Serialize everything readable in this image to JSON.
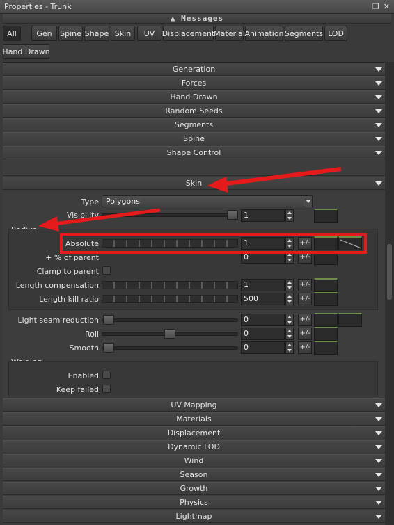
{
  "window": {
    "title": "Properties - Trunk",
    "restore_icon": "restore-icon",
    "close_icon": "close-icon"
  },
  "messages": {
    "label": "Messages"
  },
  "tabs": [
    "All",
    "Gen",
    "Spine",
    "Shape",
    "Skin",
    "UV",
    "Displacement",
    "Material",
    "Animation",
    "Segments",
    "LOD",
    "Hand Drawn"
  ],
  "sections_top": [
    "Generation",
    "Forces",
    "Hand Drawn",
    "Random Seeds",
    "Segments",
    "Spine",
    "Shape Control"
  ],
  "skin": {
    "header": "Skin",
    "type_label": "Type",
    "type_value": "Polygons",
    "visibility_label": "Visibility",
    "visibility_value": "1",
    "radius": {
      "title": "Radius",
      "absolute_label": "Absolute",
      "absolute_value": "1",
      "pct_parent_label": "+ % of parent",
      "pct_parent_value": "0",
      "clamp_label": "Clamp to parent",
      "length_comp_label": "Length compensation",
      "length_comp_value": "1",
      "length_kill_label": "Length kill ratio",
      "length_kill_value": "500"
    },
    "light_seam_label": "Light seam reduction",
    "light_seam_value": "0",
    "roll_label": "Roll",
    "roll_value": "0",
    "smooth_label": "Smooth",
    "smooth_value": "0",
    "welding": {
      "title": "Welding",
      "enabled_label": "Enabled",
      "keep_failed_label": "Keep failed"
    },
    "pm_label": "+/-"
  },
  "sections_bottom": [
    "UV Mapping",
    "Materials",
    "Displacement",
    "Dynamic LOD",
    "Wind",
    "Season",
    "Growth",
    "Physics",
    "Lightmap"
  ],
  "colors": {
    "annotation_red": "#e51b1b",
    "curve_green": "#6f8b4a"
  }
}
